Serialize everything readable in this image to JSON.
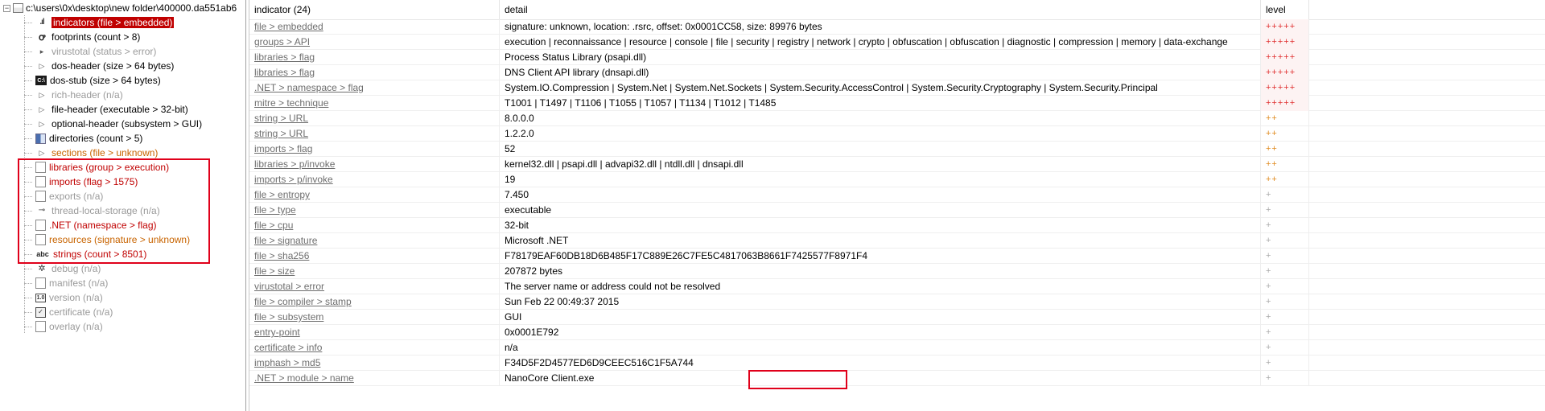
{
  "tree": {
    "root": "c:\\users\\0x\\desktop\\new folder\\400000.da551ab6",
    "items": [
      {
        "icon": "bars-icon",
        "glyph": ".ıl",
        "label": "indicators (file > embedded)",
        "style": "selected"
      },
      {
        "icon": "footprints-icon",
        "glyph": "ꝍ",
        "label": "footprints (count > 8)",
        "style": "normal"
      },
      {
        "icon": "virustotal-icon",
        "glyph": "▸",
        "label": "virustotal (status > error)",
        "style": "gray"
      },
      {
        "icon": "arrow-icon",
        "glyph": "▷",
        "label": "dos-header (size > 64 bytes)",
        "style": "normal"
      },
      {
        "icon": "dos-icon",
        "glyph": "C:\\",
        "label": "dos-stub (size > 64 bytes)",
        "style": "normal"
      },
      {
        "icon": "arrow-icon",
        "glyph": "▷",
        "label": "rich-header (n/a)",
        "style": "gray"
      },
      {
        "icon": "arrow-icon",
        "glyph": "▷",
        "label": "file-header (executable > 32-bit)",
        "style": "normal"
      },
      {
        "icon": "arrow-icon",
        "glyph": "▷",
        "label": "optional-header (subsystem > GUI)",
        "style": "normal"
      },
      {
        "icon": "directories-icon",
        "glyph": "",
        "label": "directories (count > 5)",
        "style": "normal"
      },
      {
        "icon": "arrow-icon",
        "glyph": "▷",
        "label": "sections (file > unknown)",
        "style": "orange"
      },
      {
        "icon": "libraries-icon",
        "glyph": "",
        "label": "libraries (group > execution)",
        "style": "red"
      },
      {
        "icon": "imports-icon",
        "glyph": "",
        "label": "imports (flag > 1575)",
        "style": "red"
      },
      {
        "icon": "exports-icon",
        "glyph": "",
        "label": "exports (n/a)",
        "style": "gray"
      },
      {
        "icon": "key-icon",
        "glyph": "⊸",
        "label": "thread-local-storage (n/a)",
        "style": "gray"
      },
      {
        "icon": "dotnet-icon",
        "glyph": "",
        "label": ".NET (namespace > flag)",
        "style": "red"
      },
      {
        "icon": "resources-icon",
        "glyph": "",
        "label": "resources (signature > unknown)",
        "style": "orange"
      },
      {
        "icon": "strings-icon",
        "glyph": "abc",
        "label": "strings (count > 8501)",
        "style": "red"
      },
      {
        "icon": "debug-icon",
        "glyph": "✲",
        "label": "debug (n/a)",
        "style": "gray"
      },
      {
        "icon": "manifest-icon",
        "glyph": "",
        "label": "manifest (n/a)",
        "style": "gray"
      },
      {
        "icon": "version-icon",
        "glyph": "1.0",
        "label": "version (n/a)",
        "style": "gray"
      },
      {
        "icon": "certificate-icon",
        "glyph": "✓",
        "label": "certificate (n/a)",
        "style": "gray"
      },
      {
        "icon": "overlay-icon",
        "glyph": "",
        "label": "overlay (n/a)",
        "style": "gray"
      }
    ]
  },
  "table": {
    "headers": {
      "indicator": "indicator (24)",
      "detail": "detail",
      "level": "level"
    },
    "rows": [
      {
        "indicator": "file > embedded",
        "detail": "signature: unknown, location: .rsrc, offset: 0x0001CC58, size: 89976 bytes",
        "level": "+++++",
        "sev": "hi"
      },
      {
        "indicator": "groups > API",
        "detail": "execution | reconnaissance | resource | console | file | security | registry | network | crypto | obfuscation | obfuscation | diagnostic | compression | memory | data-exchange",
        "level": "+++++",
        "sev": "hi"
      },
      {
        "indicator": "libraries > flag",
        "detail": "Process Status Library (psapi.dll)",
        "level": "+++++",
        "sev": "hi"
      },
      {
        "indicator": "libraries > flag",
        "detail": "DNS Client API library (dnsapi.dll)",
        "level": "+++++",
        "sev": "hi"
      },
      {
        "indicator": ".NET > namespace > flag",
        "detail": "System.IO.Compression | System.Net | System.Net.Sockets | System.Security.AccessControl | System.Security.Cryptography | System.Security.Principal",
        "level": "+++++",
        "sev": "hi"
      },
      {
        "indicator": "mitre > technique",
        "detail": "T1001 | T1497 | T1106 | T1055 | T1057 | T1134 | T1012 | T1485",
        "level": "+++++",
        "sev": "hi"
      },
      {
        "indicator": "string > URL",
        "detail": "8.0.0.0",
        "level": "++",
        "sev": "mid"
      },
      {
        "indicator": "string > URL",
        "detail": "1.2.2.0",
        "level": "++",
        "sev": "mid"
      },
      {
        "indicator": "imports > flag",
        "detail": "52",
        "level": "++",
        "sev": "mid"
      },
      {
        "indicator": "libraries > p/invoke",
        "detail": "kernel32.dll | psapi.dll | advapi32.dll | ntdll.dll | dnsapi.dll",
        "level": "++",
        "sev": "mid"
      },
      {
        "indicator": "imports > p/invoke",
        "detail": "19",
        "level": "++",
        "sev": "mid"
      },
      {
        "indicator": "file > entropy",
        "detail": "7.450",
        "level": "+",
        "sev": "low"
      },
      {
        "indicator": "file > type",
        "detail": "executable",
        "level": "+",
        "sev": "low"
      },
      {
        "indicator": "file > cpu",
        "detail": "32-bit",
        "level": "+",
        "sev": "low"
      },
      {
        "indicator": "file > signature",
        "detail": "Microsoft .NET",
        "level": "+",
        "sev": "low"
      },
      {
        "indicator": "file > sha256",
        "detail": "F78179EAF60DB18D6B485F17C889E26C7FE5C4817063B8661F7425577F8971F4",
        "level": "+",
        "sev": "low"
      },
      {
        "indicator": "file > size",
        "detail": "207872 bytes",
        "level": "+",
        "sev": "low"
      },
      {
        "indicator": "virustotal > error",
        "detail": "The server name or address could not be resolved",
        "level": "+",
        "sev": "low"
      },
      {
        "indicator": "file > compiler > stamp",
        "detail": "Sun Feb 22 00:49:37 2015",
        "level": "+",
        "sev": "low"
      },
      {
        "indicator": "file > subsystem",
        "detail": "GUI",
        "level": "+",
        "sev": "low"
      },
      {
        "indicator": "entry-point",
        "detail": "0x0001E792",
        "level": "+",
        "sev": "low"
      },
      {
        "indicator": "certificate > info",
        "detail": "n/a",
        "level": "+",
        "sev": "low"
      },
      {
        "indicator": "imphash > md5",
        "detail": "F34D5F2D4577ED6D9CEEC516C1F5A744",
        "level": "+",
        "sev": "low"
      },
      {
        "indicator": ".NET > module > name",
        "detail": "NanoCore Client.exe",
        "level": "+",
        "sev": "low"
      }
    ]
  },
  "colors": {
    "selected_bg": "#c00000",
    "highlight_box": "#e0001a",
    "level_high": "#e03030",
    "level_mid": "#e08a1e",
    "level_low": "#aaaaaa"
  }
}
